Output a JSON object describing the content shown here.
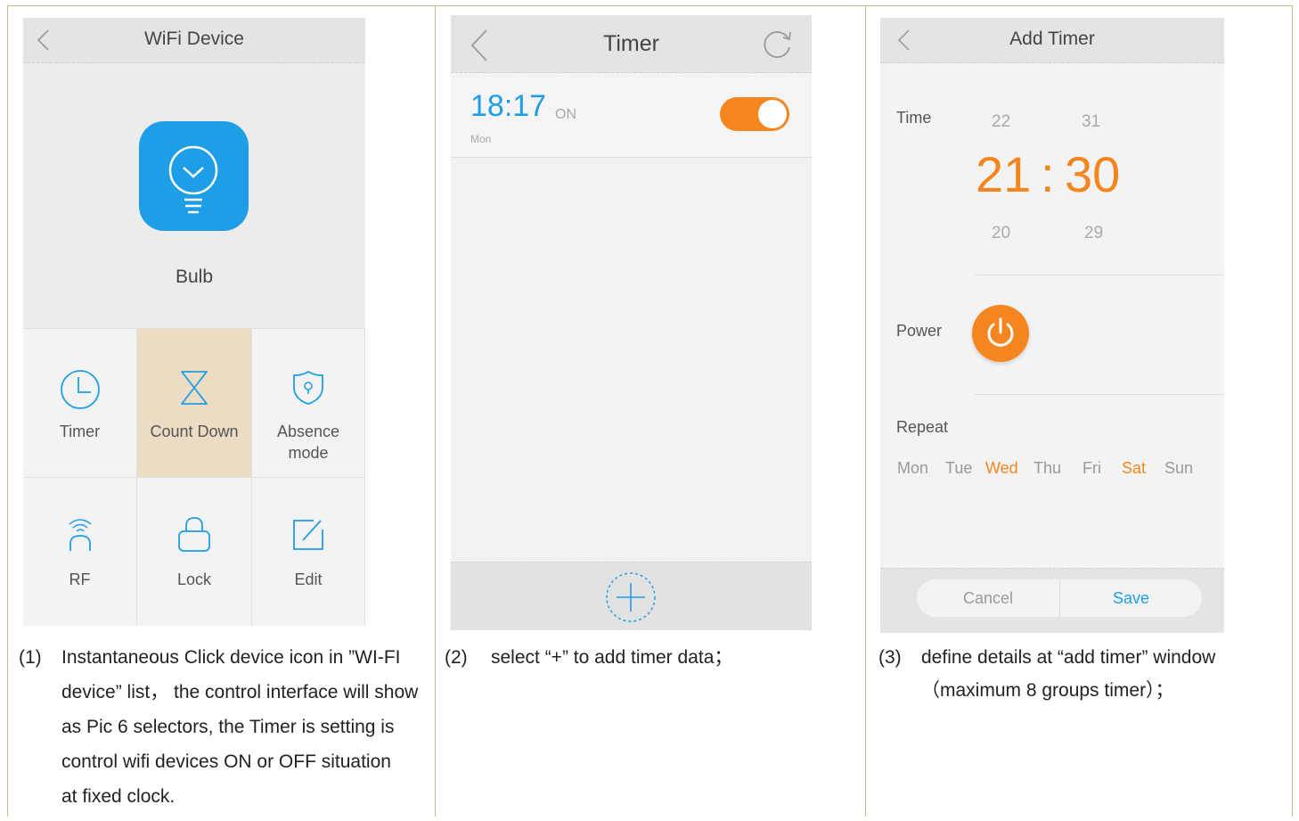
{
  "panel1": {
    "title": "WiFi Device",
    "device_label": "Bulb",
    "tiles": [
      {
        "label": "Timer",
        "icon": "clock-icon"
      },
      {
        "label": "Count Down",
        "icon": "hourglass-icon"
      },
      {
        "label": "Absence",
        "label2": "mode",
        "icon": "shield-icon"
      },
      {
        "label": "RF",
        "icon": "rf-signal-icon"
      },
      {
        "label": "Lock",
        "icon": "lock-icon"
      },
      {
        "label": "Edit",
        "icon": "edit-icon"
      }
    ],
    "caption_num": "(1)",
    "caption_lines": [
      "Instantaneous Click device icon in ”WI-FI",
      "device” list， the control interface will show",
      "as Pic 6 selectors, the Timer is setting is",
      "control wifi devices ON or OFF situation",
      "at fixed clock."
    ]
  },
  "panel2": {
    "title": "Timer",
    "timer": {
      "time": "18:17",
      "state": "ON",
      "day": "Mon"
    },
    "caption_num": "(2)",
    "caption_lines": [
      "select “+” to add timer data；"
    ]
  },
  "panel3": {
    "title": "Add Timer",
    "time_label": "Time",
    "hour_above": "22",
    "minute_above": "31",
    "hour": "21",
    "separator": ":",
    "minute": "30",
    "hour_below": "20",
    "minute_below": "29",
    "power_label": "Power",
    "repeat_label": "Repeat",
    "days": [
      {
        "label": "Mon",
        "on": false
      },
      {
        "label": "Tue",
        "on": false
      },
      {
        "label": "Wed",
        "on": true
      },
      {
        "label": "Thu",
        "on": false
      },
      {
        "label": "Fri",
        "on": false
      },
      {
        "label": "Sat",
        "on": true
      },
      {
        "label": "Sun",
        "on": false
      }
    ],
    "cancel_label": "Cancel",
    "save_label": "Save",
    "caption_num": "(3)",
    "caption_lines": [
      "define details at  “add timer” window",
      "（maximum 8 groups timer）；"
    ]
  },
  "colors": {
    "accent": "#f5861f",
    "blue": "#1e9ee6",
    "tile_active": "#ecdcc4"
  }
}
